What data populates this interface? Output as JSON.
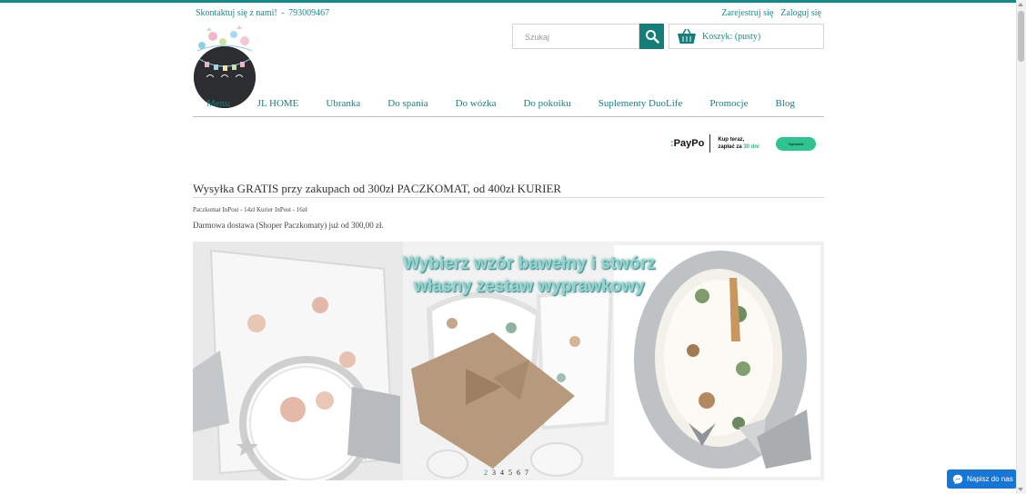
{
  "header": {
    "contact_label": "Skontaktuj się z nami!",
    "contact_separator": "-",
    "contact_phone": "793009467",
    "register_label": "Zarejestruj się",
    "login_label": "Zaloguj się"
  },
  "search": {
    "placeholder": "Szukaj"
  },
  "cart": {
    "label": "Koszyk: (pusty)"
  },
  "nav": {
    "items": [
      "Menu",
      "JL HOME",
      "Ubranka",
      "Do spania",
      "Do wózka",
      "Do pokoiku",
      "Suplementy DuoLife",
      "Promocje",
      "Blog"
    ]
  },
  "paypo": {
    "logo": "PayPo",
    "line1": "Kup teraz,",
    "line2_prefix": "zapłać za",
    "line2_highlight": "30 dni",
    "button": "Sprawdź"
  },
  "shipping": {
    "headline": "Wysyłka GRATIS przy zakupach od 300zł PACZKOMAT, od 400zł KURIER",
    "rates": "Paczkomat InPost - 14zł Kurier InPost - 16zł",
    "free_delivery": "Darmowa dostawa (Shoper Paczkomaty) już od 300,00 zł."
  },
  "banner": {
    "title_line1": "Wybierz wzór bawełny i stwórz",
    "title_line2": "własny zestaw wyprawkowy"
  },
  "pager": {
    "pages": [
      "2",
      "3",
      "4",
      "5",
      "6",
      "7"
    ],
    "active": "2"
  },
  "messenger": {
    "label": "Napisz do nas"
  },
  "colors": {
    "accent": "#1a8b86",
    "search_button": "#157d7a",
    "messenger": "#1676d6",
    "paypo_green": "#2ec38f"
  }
}
